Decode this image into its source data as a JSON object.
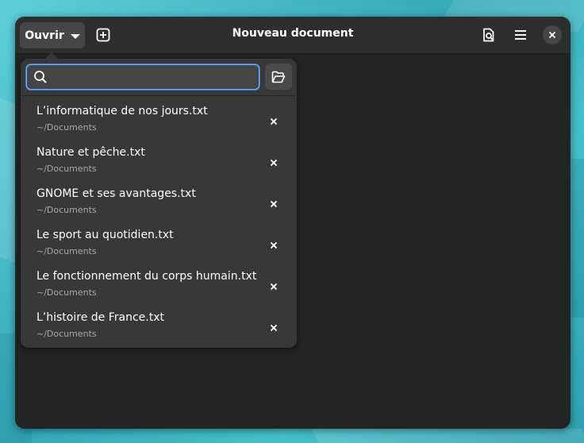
{
  "window": {
    "title": "Nouveau document"
  },
  "headerbar": {
    "open_label": "Ouvrir",
    "icons": {
      "new_tab": "new-tab-icon",
      "document_info": "document-info-icon",
      "menu": "hamburger-menu-icon",
      "close": "close-icon"
    }
  },
  "popover": {
    "search": {
      "value": "",
      "placeholder": ""
    },
    "recent_files": [
      {
        "name": "L’informatique de nos jours.txt",
        "path": "~/Documents"
      },
      {
        "name": "Nature et pêche.txt",
        "path": "~/Documents"
      },
      {
        "name": "GNOME et ses avantages.txt",
        "path": "~/Documents"
      },
      {
        "name": "Le sport au quotidien.txt",
        "path": "~/Documents"
      },
      {
        "name": "Le fonctionnement du corps humain.txt",
        "path": "~/Documents"
      },
      {
        "name": "L’histoire de France.txt",
        "path": "~/Documents"
      }
    ]
  },
  "colors": {
    "window_bg": "#242424",
    "headerbar_bg": "#2e2e2e",
    "popover_bg": "#383838",
    "focus_ring": "#3584e4",
    "subtitle_text": "#a8a8a8"
  }
}
